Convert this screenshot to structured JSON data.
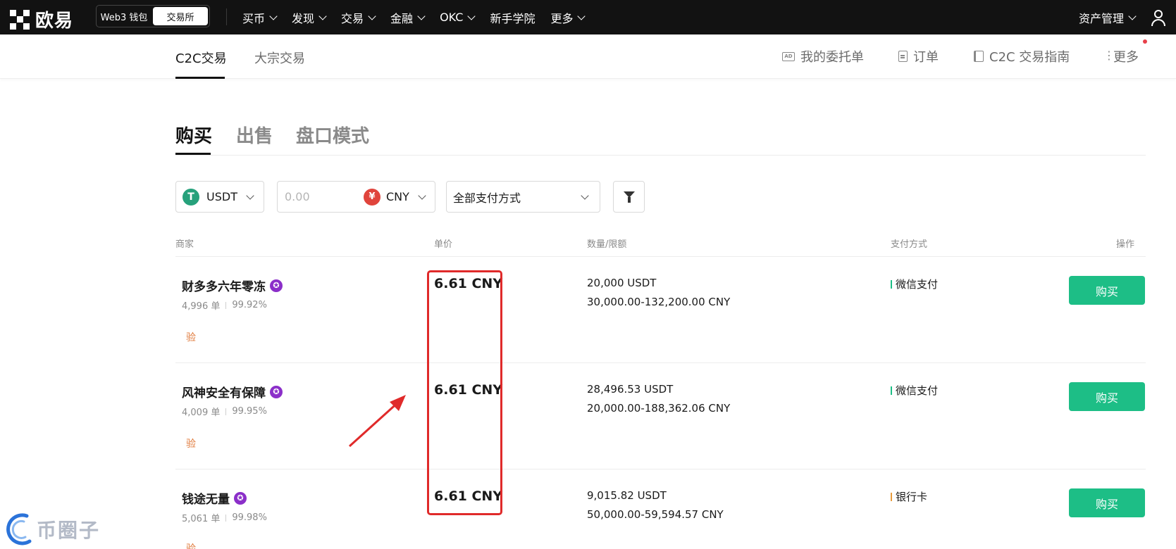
{
  "topnav": {
    "brand": "欧易",
    "wallet_switch": [
      "Web3 钱包",
      "交易所"
    ],
    "items": [
      {
        "label": "买币",
        "dropdown": true
      },
      {
        "label": "发现",
        "dropdown": true
      },
      {
        "label": "交易",
        "dropdown": true
      },
      {
        "label": "金融",
        "dropdown": true
      },
      {
        "label": "OKC",
        "dropdown": true
      },
      {
        "label": "新手学院",
        "dropdown": false
      },
      {
        "label": "更多",
        "dropdown": true
      }
    ],
    "asset_management": "资产管理"
  },
  "subnav": {
    "tabs": [
      "C2C交易",
      "大宗交易"
    ],
    "right": {
      "my_orders": "我的委托单",
      "orders": "订单",
      "guide": "C2C 交易指南",
      "more": "更多"
    }
  },
  "trade_tabs": [
    "购买",
    "出售",
    "盘口模式"
  ],
  "filters": {
    "coin": "USDT",
    "coin_glyph": "T",
    "amount_placeholder": "0.00",
    "fiat": "CNY",
    "fiat_glyph": "¥",
    "payment": "全部支付方式"
  },
  "table": {
    "headers": {
      "merchant": "商家",
      "price": "单价",
      "quantity": "数量/限额",
      "payment": "支付方式",
      "action": "操作"
    },
    "rows": [
      {
        "merchant": "财多多六年零冻",
        "orders": "4,996 单",
        "rate": "99.92%",
        "verify": "验",
        "price": "6.61 CNY",
        "quantity": "20,000 USDT",
        "limit": "30,000.00-132,200.00 CNY",
        "payment": "微信支付",
        "payment_color": "#1dbe86",
        "action": "购买"
      },
      {
        "merchant": "风神安全有保障",
        "orders": "4,009 单",
        "rate": "99.95%",
        "verify": "验",
        "price": "6.61 CNY",
        "quantity": "28,496.53 USDT",
        "limit": "20,000.00-188,362.06 CNY",
        "payment": "微信支付",
        "payment_color": "#1dbe86",
        "action": "购买"
      },
      {
        "merchant": "钱途无量",
        "orders": "5,061 单",
        "rate": "99.98%",
        "verify": "验",
        "price": "6.61 CNY",
        "quantity": "9,015.82 USDT",
        "limit": "50,000.00-59,594.57 CNY",
        "payment": "银行卡",
        "payment_color": "#e89b3b",
        "action": "购买"
      }
    ]
  },
  "watermark": "币圈子",
  "colors": {
    "accent": "#1dbe86",
    "nav_bg": "#121212",
    "annotation": "#e02a2a",
    "badge": "#8b2fc9",
    "usdt": "#26a17b",
    "cny": "#e0443c"
  }
}
